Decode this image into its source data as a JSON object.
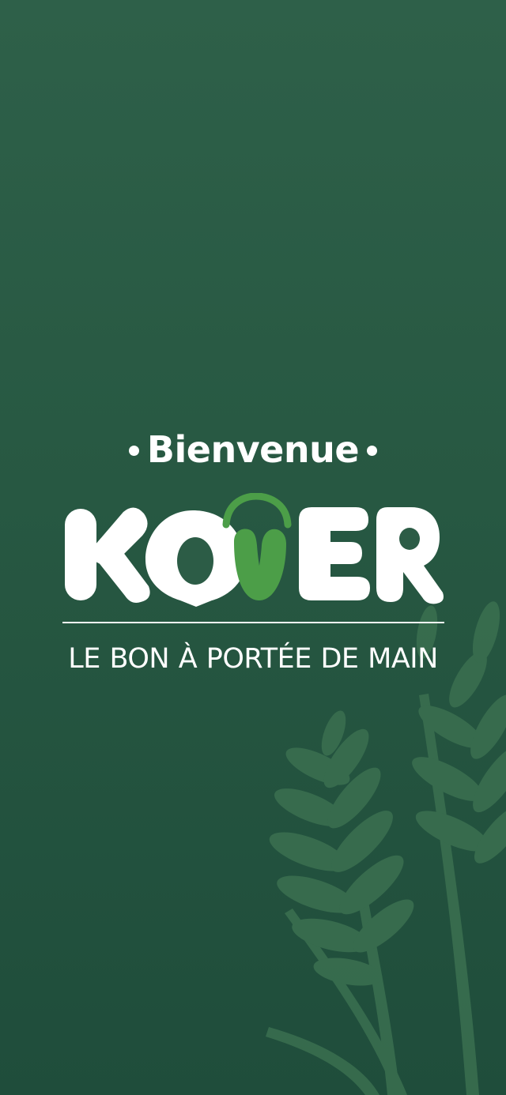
{
  "splash": {
    "welcome_text": "Bienvenue",
    "brand_name": "KOVER",
    "tagline": "LE BON À PORTÉE DE MAIN"
  },
  "colors": {
    "background_top": "#2e6049",
    "background_bottom": "#1f4d3b",
    "logo_text": "#ffffff",
    "logo_accent": "#4c9e48",
    "wheat": "#3b7050"
  },
  "icons": {
    "brand_logo": "kover-logo",
    "decoration": "wheat-icon"
  }
}
